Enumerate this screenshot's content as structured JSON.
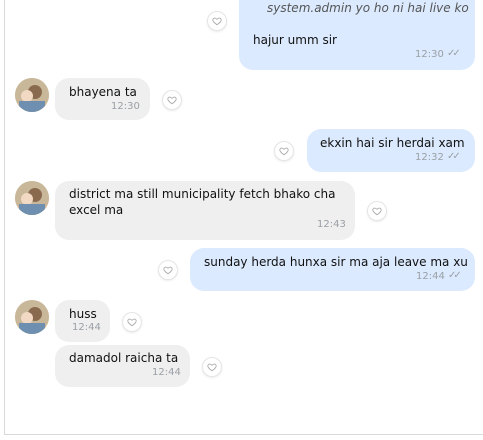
{
  "messages": [
    {
      "dir": "out",
      "quote": "system.admin yo ho ni hai live ko",
      "text": "hajur umm sir",
      "time": "12:30",
      "checks": true
    },
    {
      "dir": "in",
      "text": "bhayena ta",
      "time": "12:30"
    },
    {
      "dir": "out",
      "text": "ekxin hai sir herdai xam",
      "time": "12:32",
      "checks": true
    },
    {
      "dir": "in",
      "text": "district ma still municipality fetch bhako cha excel ma",
      "time": "12:43"
    },
    {
      "dir": "out",
      "text": "sunday herda hunxa sir ma aja leave ma xu",
      "time": "12:44",
      "checks": true
    },
    {
      "dir": "in",
      "text": "huss",
      "time": "12:44"
    },
    {
      "dir": "in",
      "text": "damadol raicha ta",
      "time": "12:44"
    }
  ],
  "colors": {
    "incoming": "#efefef",
    "outgoing": "#dbeafe",
    "time": "#9aa0a6"
  }
}
